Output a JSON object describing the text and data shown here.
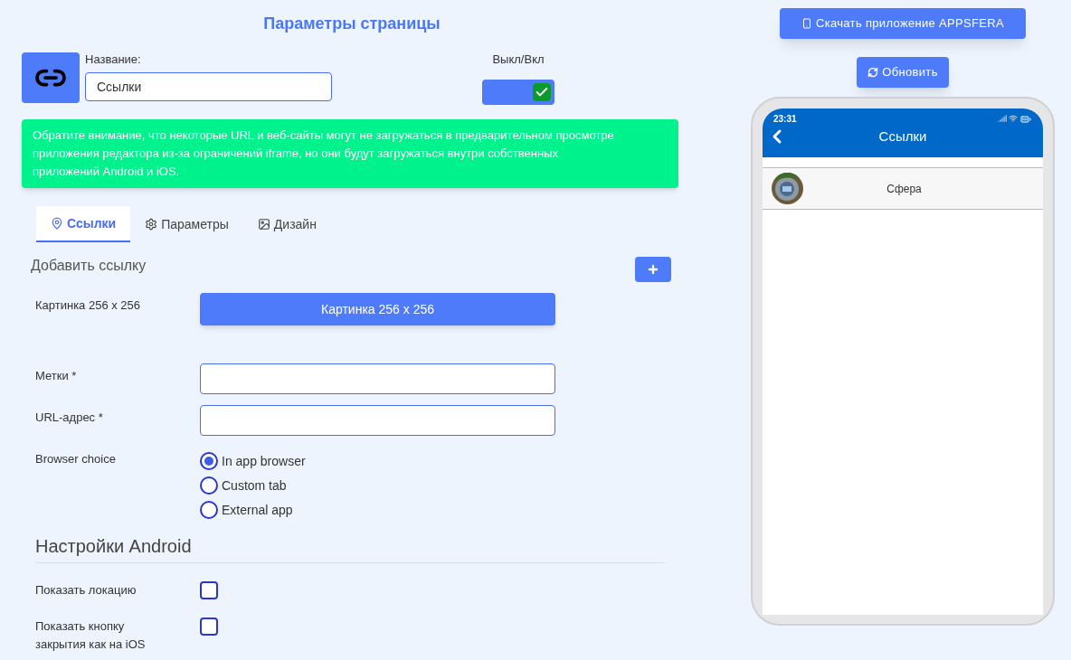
{
  "title": "Параметры страницы",
  "name_field": {
    "label": "Название:",
    "value": "Ссылки"
  },
  "toggle": {
    "label": "Выкл/Вкл",
    "on": true
  },
  "notice": "Обратите внимание, что некоторые URL и веб-сайты могут не загружаться в предварительном просмотре приложения редактора из-за ограничений iframe, но они будут загружаться внутри собственных приложений Android и iOS.",
  "tabs": [
    {
      "label": "Ссылки",
      "selected": true
    },
    {
      "label": "Параметры",
      "selected": false
    },
    {
      "label": "Дизайн",
      "selected": false
    }
  ],
  "section_title": "Добавить ссылку",
  "image_row": {
    "label": "Картинка 256 x 256",
    "button": "Картинка 256 x 256"
  },
  "fields": [
    {
      "label": "Метки *"
    },
    {
      "label": "URL-адрес *"
    }
  ],
  "browser_choice": {
    "label": "Browser choice",
    "options": [
      {
        "label": "In app browser",
        "selected": true
      },
      {
        "label": "Custom tab",
        "selected": false
      },
      {
        "label": "External app",
        "selected": false
      }
    ]
  },
  "android_title": "Настройки Android",
  "checkboxes": [
    {
      "label": "Показать локацию",
      "checked": false
    },
    {
      "label": "Показать кнопку закрытия как на iOS",
      "checked": false
    }
  ],
  "download_button": "Скачать приложение APPSFERA",
  "refresh_button": "Обновить",
  "phone": {
    "time": "23:31",
    "title": "Ссылки",
    "items": [
      {
        "label": "Сфера"
      }
    ]
  }
}
